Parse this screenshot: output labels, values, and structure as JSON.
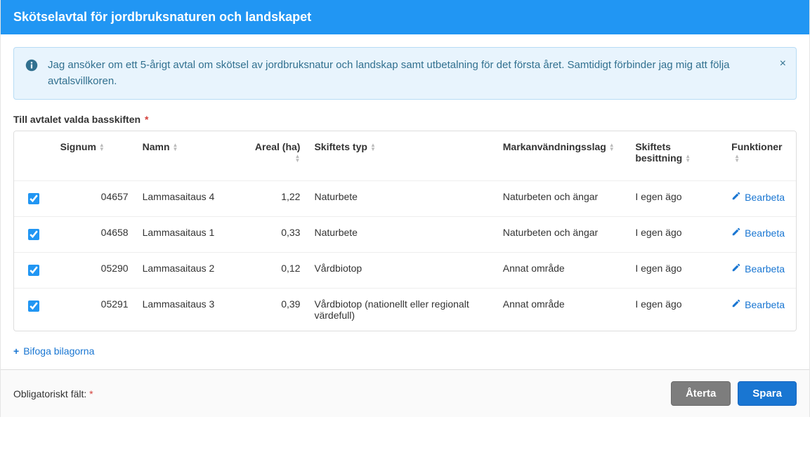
{
  "header": {
    "title": "Skötselavtal för jordbruksnaturen och landskapet"
  },
  "alert": {
    "text": "Jag ansöker om ett 5-årigt avtal om skötsel av jordbruksnatur och landskap samt utbetalning för det första året. Samtidigt förbinder jag mig att följa avtalsvillkoren.",
    "close_label": "×"
  },
  "section": {
    "label": "Till avtalet valda basskiften",
    "required_marker": "*"
  },
  "table": {
    "headers": {
      "signum": "Signum",
      "namn": "Namn",
      "areal": "Areal (ha)",
      "typ": "Skiftets typ",
      "mark": "Markanvändningsslag",
      "besitt": "Skiftets besittning",
      "funk": "Funktioner"
    },
    "action_label": "Bearbeta",
    "rows": [
      {
        "checked": true,
        "signum": "04657",
        "namn": "Lammasaitaus 4",
        "areal": "1,22",
        "typ": "Naturbete",
        "mark": "Naturbeten och ängar",
        "besitt": "I egen ägo"
      },
      {
        "checked": true,
        "signum": "04658",
        "namn": "Lammasaitaus 1",
        "areal": "0,33",
        "typ": "Naturbete",
        "mark": "Naturbeten och ängar",
        "besitt": "I egen ägo"
      },
      {
        "checked": true,
        "signum": "05290",
        "namn": "Lammasaitaus 2",
        "areal": "0,12",
        "typ": "Vårdbiotop",
        "mark": "Annat område",
        "besitt": "I egen ägo"
      },
      {
        "checked": true,
        "signum": "05291",
        "namn": "Lammasaitaus 3",
        "areal": "0,39",
        "typ": "Vårdbiotop (nationellt eller regionalt värdefull)",
        "mark": "Annat område",
        "besitt": "I egen ägo"
      }
    ]
  },
  "attach": {
    "label": "Bifoga bilagorna",
    "plus": "+"
  },
  "footer": {
    "required_label": "Obligatoriskt fält:",
    "required_marker": "*",
    "revert": "Återta",
    "save": "Spara"
  }
}
